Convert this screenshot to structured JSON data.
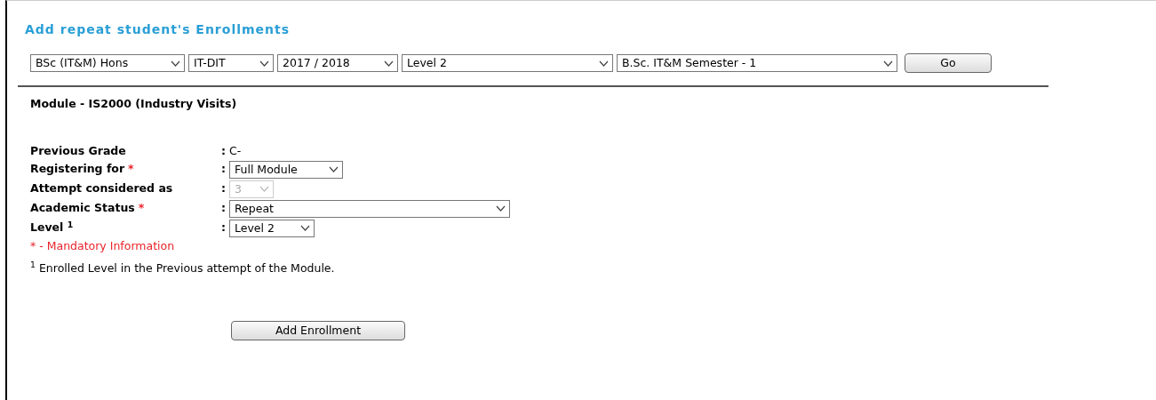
{
  "title": "Add repeat student's Enrollments",
  "filters": [
    {
      "value": "BSc (IT&M) Hons"
    },
    {
      "value": "IT-DIT"
    },
    {
      "value": "2017 / 2018"
    },
    {
      "value": "Level 2"
    },
    {
      "value": "B.Sc. IT&M Semester - 1"
    }
  ],
  "go_button": "Go",
  "module_heading": "Module - IS2000 (Industry Visits)",
  "fields": [
    {
      "label": "Previous Grade",
      "separator": ":",
      "kind": "text",
      "value": "C-"
    },
    {
      "label": "Registering for",
      "required_mark": "*",
      "separator": ":",
      "kind": "select",
      "value": "Full Module",
      "disabled": false
    },
    {
      "label": "Attempt considered as",
      "separator": ":",
      "kind": "select",
      "value": "3",
      "disabled": true
    },
    {
      "label": "Academic Status",
      "required_mark": "*",
      "separator": ":",
      "kind": "select",
      "value": "Repeat",
      "disabled": false
    },
    {
      "label": "Level $^{1}$",
      "separator": ":",
      "kind": "select",
      "value": "Level 2",
      "disabled": false
    }
  ],
  "mandatory_note": "* - Mandatory Information",
  "footnote": "$^{1}$ Enrolled Level in the Previous attempt of the Module.",
  "submit_button": "Add Enrollment"
}
